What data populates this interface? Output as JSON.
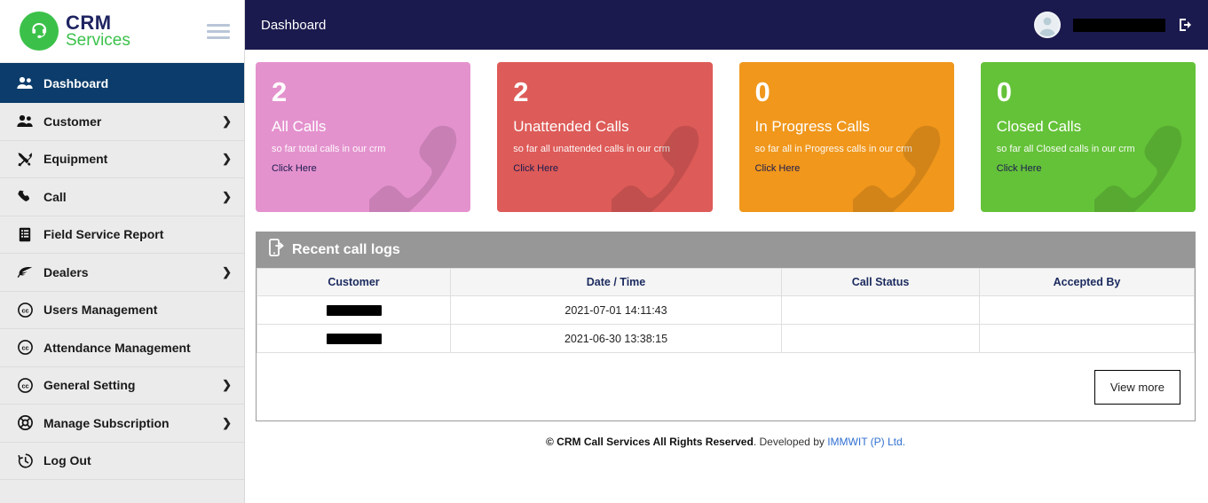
{
  "brand": {
    "name_primary": "CRM",
    "name_secondary": "Services",
    "logo_icon": "headset-circle-icon",
    "green": "#3bc14a",
    "navy": "#1f2461"
  },
  "header": {
    "title": "Dashboard",
    "background": "#1b1a4e",
    "user_name": "",
    "avatar_icon": "user-avatar-icon",
    "signout_icon": "sign-out-icon",
    "menu_toggle_icon": "hamburger-icon"
  },
  "sidebar": {
    "items": [
      {
        "label": "Dashboard",
        "icon": "users-icon",
        "active": true,
        "chevron": false
      },
      {
        "label": "Customer",
        "icon": "users-icon",
        "active": false,
        "chevron": true
      },
      {
        "label": "Equipment",
        "icon": "tools-icon",
        "active": false,
        "chevron": true
      },
      {
        "label": "Call",
        "icon": "phone-icon",
        "active": false,
        "chevron": true
      },
      {
        "label": "Field Service Report",
        "icon": "list-alt-icon",
        "active": false,
        "chevron": false
      },
      {
        "label": "Dealers",
        "icon": "leaf-icon",
        "active": false,
        "chevron": true
      },
      {
        "label": "Users Management",
        "icon": "creative-commons-icon",
        "active": false,
        "chevron": false
      },
      {
        "label": "Attendance Management",
        "icon": "creative-commons-icon",
        "active": false,
        "chevron": false
      },
      {
        "label": "General Setting",
        "icon": "creative-commons-icon",
        "active": false,
        "chevron": true
      },
      {
        "label": "Manage Subscription",
        "icon": "life-ring-icon",
        "active": false,
        "chevron": true
      },
      {
        "label": "Log Out",
        "icon": "history-icon",
        "active": false,
        "chevron": false
      }
    ],
    "chevron_glyph": "❯"
  },
  "cards": [
    {
      "value": "2",
      "label": "All Calls",
      "description": "so far total calls in our crm",
      "link": "Click Here",
      "color": "#e492ce",
      "icon": "phone-watermark-icon"
    },
    {
      "value": "2",
      "label": "Unattended Calls",
      "description": "so far all unattended calls in our crm",
      "link": "Click Here",
      "color": "#dd5b58",
      "icon": "phone-watermark-icon"
    },
    {
      "value": "0",
      "label": "In Progress Calls",
      "description": "so far all in Progress calls in our crm",
      "link": "Click Here",
      "color": "#f0971c",
      "icon": "phone-watermark-icon"
    },
    {
      "value": "0",
      "label": "Closed Calls",
      "description": "so far all Closed calls in our crm",
      "link": "Click Here",
      "color": "#64c238",
      "icon": "phone-watermark-icon"
    }
  ],
  "panel": {
    "title": "Recent call logs",
    "icon": "mobile-export-icon",
    "columns": [
      "Customer",
      "Date / Time",
      "Call Status",
      "Accepted By"
    ],
    "rows": [
      {
        "customer": "",
        "datetime": "2021-07-01 14:11:43",
        "status": "",
        "accepted_by": ""
      },
      {
        "customer": "",
        "datetime": "2021-06-30 13:38:15",
        "status": "",
        "accepted_by": ""
      }
    ],
    "view_more_label": "View more"
  },
  "footer": {
    "copyright": "© CRM Call Services All Rights Reserved",
    "developed_by": ". Developed by ",
    "company": "IMMWIT (P) Ltd.",
    "link_color": "#2f6fd0"
  }
}
